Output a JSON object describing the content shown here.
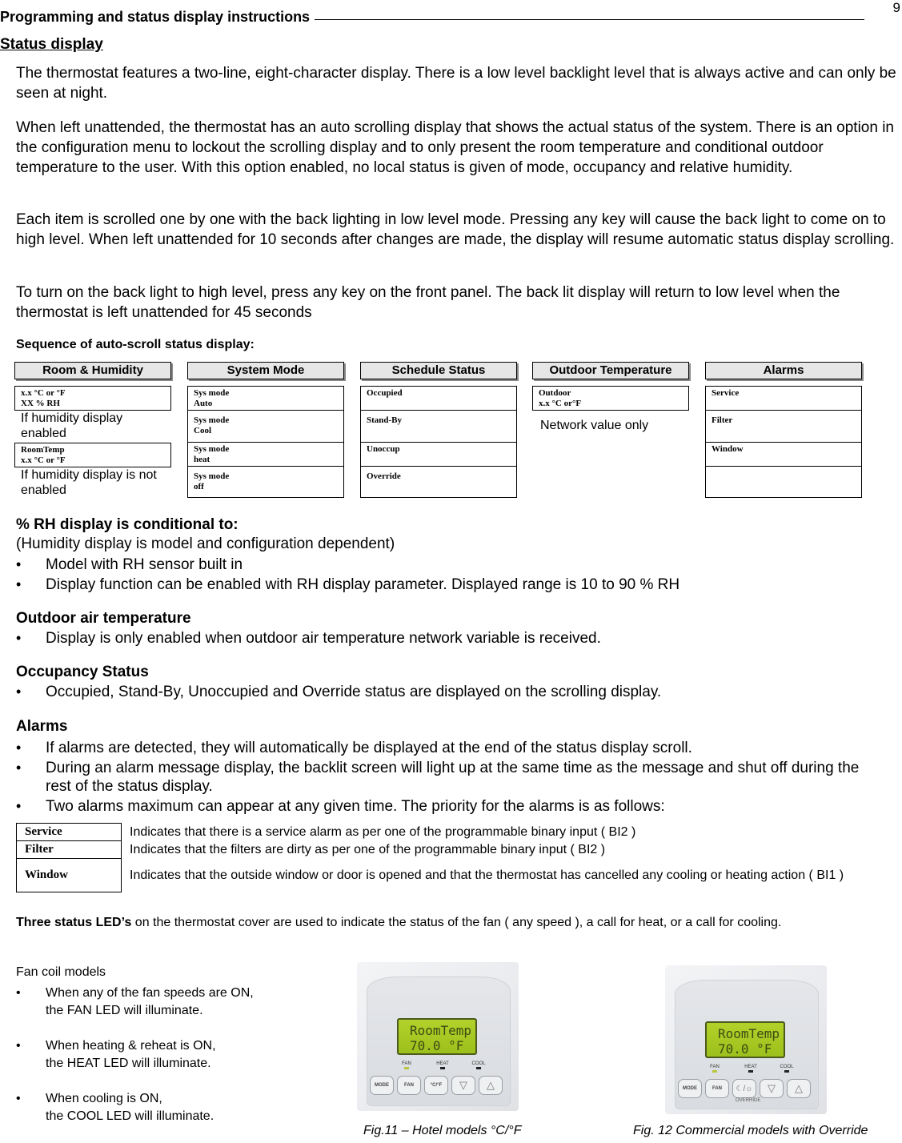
{
  "page_number": "9",
  "section_title": "Programming and status display instructions",
  "subsection_title": "Status display",
  "paragraphs": [
    "The thermostat features a two-line, eight-character display. There is a low level backlight level that is always active and can only be seen at night.",
    "When left unattended, the thermostat has an auto scrolling display that shows the actual status of the system. There is an option in the configuration menu to lockout the scrolling display and to only present the room temperature and conditional outdoor temperature to the user. With this option enabled, no local status is given of mode, occupancy and relative humidity.",
    "Each item is scrolled one by one with the back lighting in low level mode. Pressing any key will cause the back light to come on to high level. When left unattended for 10 seconds after changes are made, the display will resume automatic status display scrolling.",
    "To turn on the back light to high level, press any key on the front panel. The back lit display will return to low level when the thermostat is left unattended for 45 seconds"
  ],
  "sequence": {
    "heading": "Sequence of auto-scroll status display:",
    "room_humidity": {
      "title": "Room & Humidity",
      "box1": [
        "x.x °C or °F",
        "XX % RH"
      ],
      "note1": "If humidity display enabled",
      "box2": [
        "RoomTemp",
        "x.x °C or °F"
      ],
      "note2": "If humidity display is not enabled"
    },
    "system_mode": {
      "title": "System Mode",
      "items": [
        [
          "Sys mode",
          "Auto"
        ],
        [
          "Sys mode",
          "Cool"
        ],
        [
          "Sys mode",
          "heat"
        ],
        [
          "Sys mode",
          "off"
        ]
      ]
    },
    "schedule_status": {
      "title": "Schedule Status",
      "items": [
        "Occupied",
        "Stand-By",
        "Unoccup",
        "Override"
      ]
    },
    "outdoor_temperature": {
      "title": "Outdoor Temperature",
      "box": [
        "Outdoor",
        "x.x °C or°F"
      ],
      "note": "Network value only"
    },
    "alarms": {
      "title": "Alarms",
      "items": [
        "Service",
        "Filter",
        "Window",
        ""
      ]
    }
  },
  "rh_section": {
    "heading": "% RH display is conditional to:",
    "subheading": "(Humidity display is model and configuration dependent)",
    "bullets": [
      "Model with RH sensor built in",
      "Display function can be enabled with RH display parameter. Displayed range is 10 to 90 % RH"
    ]
  },
  "outdoor_section": {
    "heading": "Outdoor air temperature",
    "bullets": [
      "Display is only enabled when outdoor air temperature network variable is received."
    ]
  },
  "occupancy_section": {
    "heading": "Occupancy Status",
    "bullets": [
      "Occupied, Stand-By, Unoccupied and Override status are displayed on the scrolling display."
    ]
  },
  "alarms_section": {
    "heading": "Alarms",
    "bullets": [
      "If alarms are detected, they will automatically be displayed at the end of the status display scroll.",
      "During an alarm message display, the backlit screen will light up at the same time as the message and shut off during the rest of the status display.",
      "Two alarms maximum can appear at any given time. The priority for the alarms is as follows:"
    ],
    "priority_table": [
      {
        "name": "Service",
        "description": "Indicates that there is a service alarm as per one of the programmable binary input ( BI2 )"
      },
      {
        "name": "Filter",
        "description": "Indicates that the filters are dirty as per one of the programmable binary input ( BI2 )"
      },
      {
        "name": "Window",
        "description": "Indicates that the outside window or door is opened and that the thermostat has cancelled any cooling or heating action ( BI1 )"
      }
    ]
  },
  "led_section": {
    "bold_lead": "Three status LED’s",
    "text": " on the thermostat cover are used to indicate the status of the fan ( any speed ), a call for heat, or a call for cooling.",
    "fan_coil_title": "Fan coil models",
    "fan_coil_bullets": [
      [
        "When any of the fan speeds are ON,",
        "the FAN LED will illuminate."
      ],
      [
        "When heating & reheat is ON,",
        "the HEAT LED will illuminate."
      ],
      [
        "When cooling is ON,",
        "the COOL LED will illuminate."
      ]
    ]
  },
  "figures": [
    {
      "caption": "Fig.11 – Hotel models °C/°F",
      "lcd_line1": "RoomTemp",
      "lcd_line2": "70.0 °F",
      "leds": [
        {
          "label": "FAN",
          "on": true
        },
        {
          "label": "HEAT",
          "on": false
        },
        {
          "label": "COOL",
          "on": false
        }
      ],
      "buttons": [
        "MODE",
        "FAN",
        "°C/°F",
        "▽",
        "△"
      ]
    },
    {
      "caption": "Fig. 12 Commercial models with Override",
      "lcd_line1": "RoomTemp",
      "lcd_line2": "70.0 °F",
      "leds": [
        {
          "label": "FAN",
          "on": true
        },
        {
          "label": "HEAT",
          "on": false
        },
        {
          "label": "COOL",
          "on": false
        }
      ],
      "buttons": [
        "MODE",
        "FAN",
        "☾/☼",
        "▽",
        "△"
      ],
      "override_label": "OVERRIDE"
    }
  ]
}
